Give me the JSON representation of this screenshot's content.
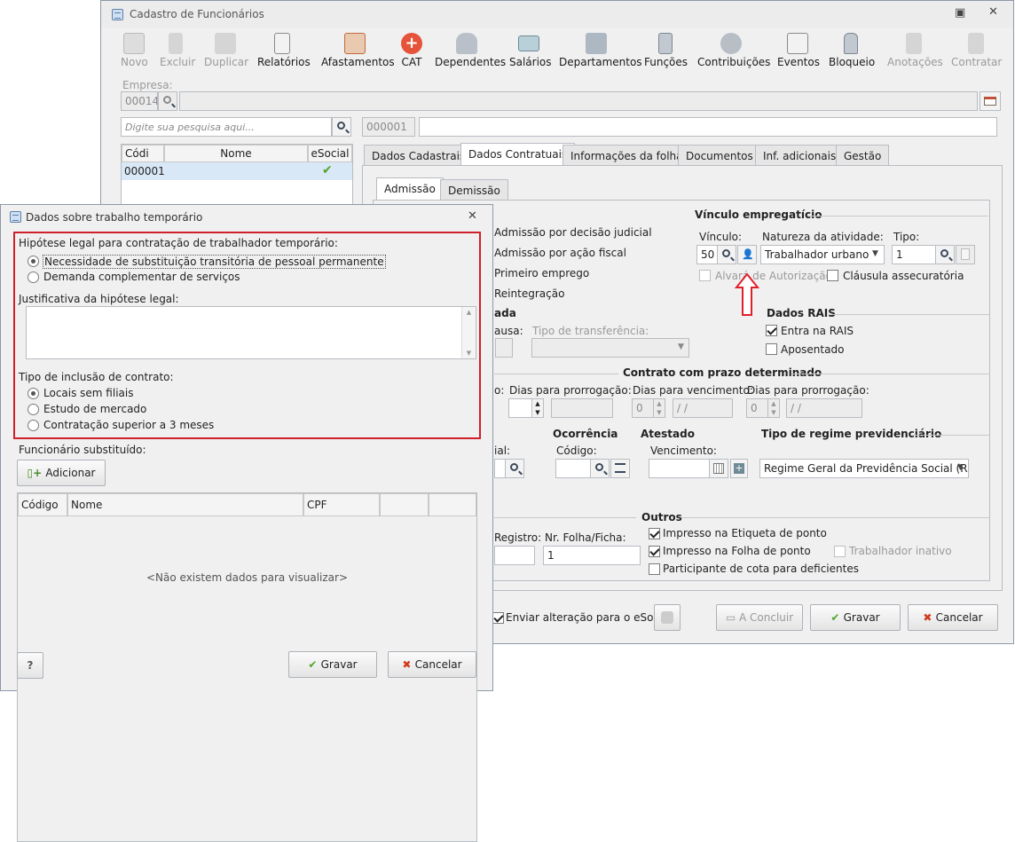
{
  "main_window": {
    "title": "Cadastro de Funcionários",
    "toolbar": [
      {
        "label": "Novo",
        "icon": "new-doc-icon",
        "enabled": false
      },
      {
        "label": "Excluir",
        "icon": "trash-icon",
        "enabled": false
      },
      {
        "label": "Duplicar",
        "icon": "duplicate-users-icon",
        "enabled": false
      },
      {
        "label": "Relatórios",
        "icon": "report-icon",
        "enabled": true
      },
      {
        "label": "Afastamentos",
        "icon": "house-arrow-icon",
        "enabled": true
      },
      {
        "label": "CAT",
        "icon": "medical-cross-icon",
        "enabled": true
      },
      {
        "label": "Dependentes",
        "icon": "people-icon",
        "enabled": true
      },
      {
        "label": "Salários",
        "icon": "money-icon",
        "enabled": true
      },
      {
        "label": "Departamentos",
        "icon": "desk-icon",
        "enabled": true
      },
      {
        "label": "Funções",
        "icon": "briefcase-icon",
        "enabled": true
      },
      {
        "label": "Contribuições",
        "icon": "contribution-icon",
        "enabled": true
      },
      {
        "label": "Eventos",
        "icon": "list-icon",
        "enabled": true
      },
      {
        "label": "Bloqueio",
        "icon": "lock-icon",
        "enabled": true
      },
      {
        "label": "Anotações",
        "icon": "notes-icon",
        "enabled": false
      },
      {
        "label": "Contratar",
        "icon": "hire-icon",
        "enabled": false
      }
    ],
    "empresa_label": "Empresa:",
    "empresa_code": "00014",
    "search_placeholder": "Digite sua pesquisa aqui...",
    "employee_code": "000001",
    "list_headers": [
      "Códi",
      "Nome",
      "eSocial"
    ],
    "list_rows": [
      {
        "codigo": "000001",
        "nome": "",
        "esocial": "ok"
      }
    ],
    "tabs": [
      "Dados Cadastrais",
      "Dados Contratuais",
      "Informações da folha",
      "Documentos",
      "Inf. adicionais",
      "Gestão"
    ],
    "active_tab": "Dados Contratuais",
    "subtabs": [
      "Admissão",
      "Demissão"
    ],
    "admissao_options": [
      "Admissão por decisão judicial",
      "Admissão por ação fiscal",
      "Primeiro emprego",
      "Reintegração"
    ],
    "vinculo": {
      "section": "Vínculo empregatício",
      "vinculo_label": "Vínculo:",
      "vinculo_value": "50",
      "natureza_label": "Natureza da atividade:",
      "natureza_value": "Trabalhador urbano",
      "tipo_label": "Tipo:",
      "tipo_value": "1",
      "alvara": "Alvará de Autorização",
      "clausula": "Cláusula assecuratória"
    },
    "transfer": {
      "section_fragment": "ada",
      "causa_fragment": "ausa:",
      "tipo_transferencia_label": "Tipo de transferência:"
    },
    "rais": {
      "section": "Dados RAIS",
      "entra": "Entra na RAIS",
      "aposentado": "Aposentado"
    },
    "prazo": {
      "section": "Contrato com prazo determinado",
      "fragment": "o:",
      "dias_prorrogacao": "Dias para prorrogação:",
      "dias_vencimento": "Dias para vencimento:",
      "zero": "0",
      "date": " /  /"
    },
    "lower": {
      "fragment": "ial:",
      "ocorrencia": "Ocorrência",
      "codigo_label": "Código:",
      "atestado": "Atestado",
      "vencimento_label": "Vencimento:",
      "regime_section": "Tipo de regime previdenciário",
      "regime_value": "Regime Geral da Previdência Social (RGP"
    },
    "outros": {
      "section": "Outros",
      "registro_fragment": "Registro:",
      "folha_label": "Nr. Folha/Ficha:",
      "folha_value": "1",
      "etiqueta": "Impresso na Etiqueta de ponto",
      "folha_ponto": "Impresso na Folha de ponto",
      "inativo": "Trabalhador inativo",
      "cota": "Participante de cota para deficientes"
    },
    "footer": {
      "esocial": "Enviar alteração para o eSocial",
      "concluir": "A Concluir",
      "gravar": "Gravar",
      "cancelar": "Cancelar"
    }
  },
  "dialog": {
    "title": "Dados sobre trabalho temporário",
    "hipotese_label": "Hipótese legal para contratação de trabalhador temporário:",
    "hipotese_options": [
      "Necessidade de substituição transitória de pessoal permanente",
      "Demanda complementar de serviços"
    ],
    "justificativa_label": "Justificativa da hipótese legal:",
    "tipo_inclusao_label": "Tipo de inclusão de contrato:",
    "tipo_inclusao_options": [
      "Locais sem filiais",
      "Estudo de mercado",
      "Contratação superior a 3 meses"
    ],
    "substituido_label": "Funcionário substituído:",
    "adicionar": "Adicionar",
    "grid_headers": [
      "Código",
      "Nome",
      "CPF",
      "",
      ""
    ],
    "empty_text": "<Não existem dados para visualizar>",
    "help": "?",
    "gravar": "Gravar",
    "cancelar": "Cancelar"
  },
  "colors": {
    "highlight": "#d0202c",
    "arrow": "#e0202a",
    "ok": "#52a42a"
  }
}
